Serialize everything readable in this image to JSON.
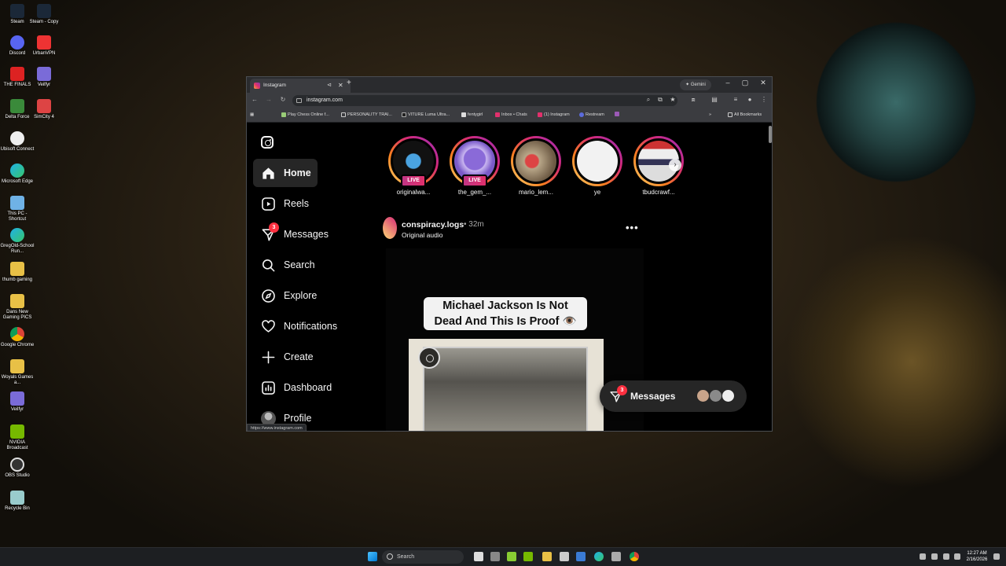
{
  "desktop": {
    "icons": [
      "Steam",
      "Steam - Copy",
      "Discord",
      "UrbanVPN",
      "THE FINALS",
      "Veilfyr",
      "Delta Force",
      "SimCity 4",
      "Ubisoft Connect",
      "Microsoft Edge",
      "This PC - Shortcut",
      "GregOld-School Run...",
      "thumb gaming",
      "Dans New Gaming PICS",
      "Google Chrome",
      "Woyals Games a...",
      "Veilfyr",
      "NVIDIA Broadcast",
      "OBS Studio",
      "Recycle Bin"
    ]
  },
  "browser": {
    "tab_title": "Instagram",
    "gemini_label": "Gemini",
    "url": "instagram.com",
    "bookmarks": [
      "Play Chess Online f...",
      "PERSONALITY TRAI...",
      "VITURE Luma Ultra...",
      "fentygirl",
      "Inbox • Chats",
      "(1) Instagram",
      "Restream",
      "All Bookmarks"
    ],
    "status_url": "https://www.instagram.com"
  },
  "nav": {
    "home": "Home",
    "reels": "Reels",
    "messages": "Messages",
    "messages_badge": "3",
    "search": "Search",
    "explore": "Explore",
    "notifications": "Notifications",
    "create": "Create",
    "dashboard": "Dashboard",
    "profile": "Profile"
  },
  "stories": [
    {
      "name": "originalwa...",
      "live": "LIVE"
    },
    {
      "name": "the_gem_...",
      "live": "LIVE"
    },
    {
      "name": "mario_lem..."
    },
    {
      "name": "ye"
    },
    {
      "name": "tbudcrawf..."
    }
  ],
  "post": {
    "username": "conspiracy.logs",
    "time": "• 32m",
    "audio": "Original audio",
    "caption_line1": "Michael Jackson Is Not",
    "caption_line2": "Dead And This Is Proof 👁️"
  },
  "messages_widget": {
    "label": "Messages",
    "badge": "3"
  },
  "taskbar": {
    "search_label": "Search",
    "time": "12:27 AM",
    "date": "2/16/2026"
  },
  "colors": {
    "instagram_live": "#e1306c",
    "badge_red": "#ff3040",
    "ig_background": "#000000"
  }
}
